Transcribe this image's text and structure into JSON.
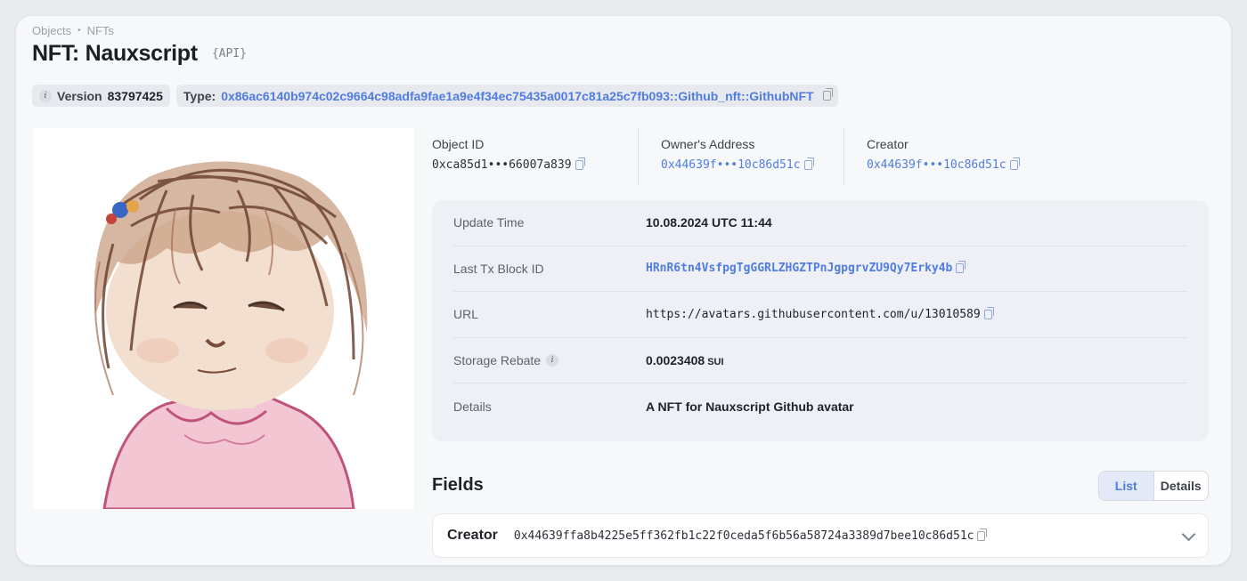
{
  "breadcrumb": {
    "item1": "Objects",
    "sep": "•",
    "item2": "NFTs"
  },
  "header": {
    "title": "NFT: Nauxscript",
    "api_label": "{API}"
  },
  "meta": {
    "version_label": "Version",
    "version_value": "83797425",
    "type_label": "Type:",
    "type_value": "0x86ac6140b974c02c9664c98adfa9fae1a9e4f34ec75435a0017c81a25c7fb093::Github_nft::GithubNFT"
  },
  "ids": [
    {
      "label": "Object ID",
      "value": "0xca85d1•••66007a839"
    },
    {
      "label": "Owner's Address",
      "value": "0x44639f•••10c86d51c"
    },
    {
      "label": "Creator",
      "value": "0x44639f•••10c86d51c"
    }
  ],
  "details": {
    "update_time_label": "Update Time",
    "update_time_value": "10.08.2024 UTC 11:44",
    "last_tx_label": "Last Tx Block ID",
    "last_tx_value": "HRnR6tn4VsfpgTgGGRLZHGZTPnJgpgrvZU9Qy7Erky4b",
    "url_label": "URL",
    "url_value": "https://avatars.githubusercontent.com/u/13010589",
    "storage_label": "Storage Rebate",
    "storage_value": "0.0023408",
    "storage_unit": "SUI",
    "details_label": "Details",
    "details_value": "A NFT for Nauxscript Github avatar"
  },
  "fields": {
    "title": "Fields",
    "toggle_list": "List",
    "toggle_details": "Details",
    "creator_key": "Creator",
    "creator_value": "0x44639ffa8b4225e5ff362fb1c22f0ceda5f6b56a58724a3389d7bee10c86d51c"
  },
  "icons": [
    "info-icon",
    "copy-icon",
    "chevron-down-icon"
  ],
  "colors": {
    "link": "#4f7de2",
    "card_bg": "#f7f8fa",
    "details_bg": "#eef0f5"
  }
}
